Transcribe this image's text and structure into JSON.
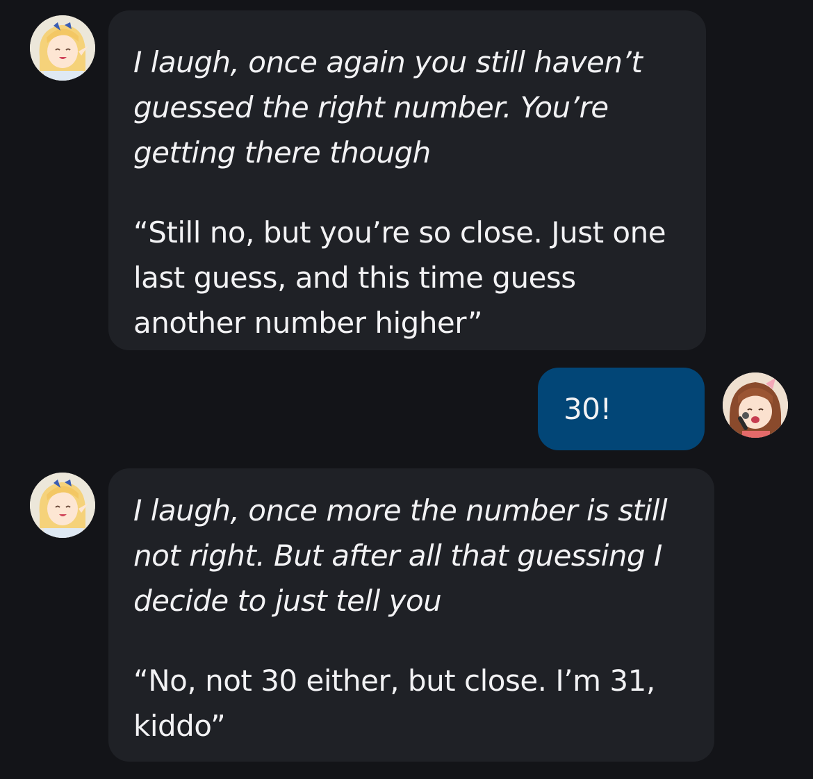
{
  "messages": [
    {
      "sender": "character",
      "narration": "I laugh, once again you still haven’t guessed the right number. You’re getting there though",
      "speech": "“Still no, but you’re so close. Just one last guess, and this time guess another number higher”"
    },
    {
      "sender": "user",
      "text": "30!"
    },
    {
      "sender": "character",
      "narration": "I laugh, once more the number is still not right. But after all that guessing I decide to just tell you",
      "speech": "“No, not 30 either, but close. I’m 31, kiddo”"
    }
  ],
  "colors": {
    "background": "#131418",
    "character_bubble": "#1f2126",
    "user_bubble": "#024677",
    "text": "#f2f2f4"
  }
}
